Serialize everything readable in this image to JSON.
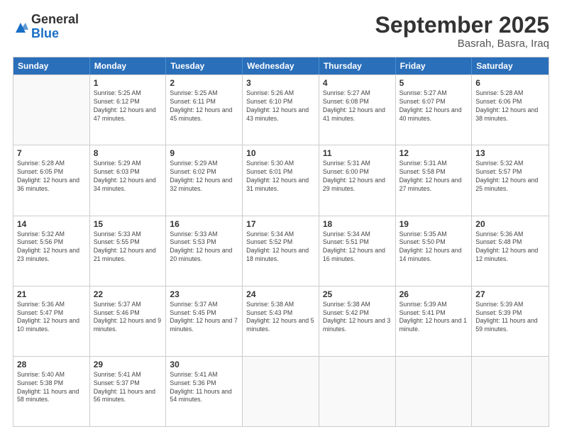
{
  "logo": {
    "general": "General",
    "blue": "Blue"
  },
  "header": {
    "month": "September 2025",
    "location": "Basrah, Basra, Iraq"
  },
  "days_of_week": [
    "Sunday",
    "Monday",
    "Tuesday",
    "Wednesday",
    "Thursday",
    "Friday",
    "Saturday"
  ],
  "weeks": [
    [
      {
        "day": "",
        "empty": true
      },
      {
        "day": "1",
        "sunrise": "Sunrise: 5:25 AM",
        "sunset": "Sunset: 6:12 PM",
        "daylight": "Daylight: 12 hours and 47 minutes."
      },
      {
        "day": "2",
        "sunrise": "Sunrise: 5:25 AM",
        "sunset": "Sunset: 6:11 PM",
        "daylight": "Daylight: 12 hours and 45 minutes."
      },
      {
        "day": "3",
        "sunrise": "Sunrise: 5:26 AM",
        "sunset": "Sunset: 6:10 PM",
        "daylight": "Daylight: 12 hours and 43 minutes."
      },
      {
        "day": "4",
        "sunrise": "Sunrise: 5:27 AM",
        "sunset": "Sunset: 6:08 PM",
        "daylight": "Daylight: 12 hours and 41 minutes."
      },
      {
        "day": "5",
        "sunrise": "Sunrise: 5:27 AM",
        "sunset": "Sunset: 6:07 PM",
        "daylight": "Daylight: 12 hours and 40 minutes."
      },
      {
        "day": "6",
        "sunrise": "Sunrise: 5:28 AM",
        "sunset": "Sunset: 6:06 PM",
        "daylight": "Daylight: 12 hours and 38 minutes."
      }
    ],
    [
      {
        "day": "7",
        "sunrise": "Sunrise: 5:28 AM",
        "sunset": "Sunset: 6:05 PM",
        "daylight": "Daylight: 12 hours and 36 minutes."
      },
      {
        "day": "8",
        "sunrise": "Sunrise: 5:29 AM",
        "sunset": "Sunset: 6:03 PM",
        "daylight": "Daylight: 12 hours and 34 minutes."
      },
      {
        "day": "9",
        "sunrise": "Sunrise: 5:29 AM",
        "sunset": "Sunset: 6:02 PM",
        "daylight": "Daylight: 12 hours and 32 minutes."
      },
      {
        "day": "10",
        "sunrise": "Sunrise: 5:30 AM",
        "sunset": "Sunset: 6:01 PM",
        "daylight": "Daylight: 12 hours and 31 minutes."
      },
      {
        "day": "11",
        "sunrise": "Sunrise: 5:31 AM",
        "sunset": "Sunset: 6:00 PM",
        "daylight": "Daylight: 12 hours and 29 minutes."
      },
      {
        "day": "12",
        "sunrise": "Sunrise: 5:31 AM",
        "sunset": "Sunset: 5:58 PM",
        "daylight": "Daylight: 12 hours and 27 minutes."
      },
      {
        "day": "13",
        "sunrise": "Sunrise: 5:32 AM",
        "sunset": "Sunset: 5:57 PM",
        "daylight": "Daylight: 12 hours and 25 minutes."
      }
    ],
    [
      {
        "day": "14",
        "sunrise": "Sunrise: 5:32 AM",
        "sunset": "Sunset: 5:56 PM",
        "daylight": "Daylight: 12 hours and 23 minutes."
      },
      {
        "day": "15",
        "sunrise": "Sunrise: 5:33 AM",
        "sunset": "Sunset: 5:55 PM",
        "daylight": "Daylight: 12 hours and 21 minutes."
      },
      {
        "day": "16",
        "sunrise": "Sunrise: 5:33 AM",
        "sunset": "Sunset: 5:53 PM",
        "daylight": "Daylight: 12 hours and 20 minutes."
      },
      {
        "day": "17",
        "sunrise": "Sunrise: 5:34 AM",
        "sunset": "Sunset: 5:52 PM",
        "daylight": "Daylight: 12 hours and 18 minutes."
      },
      {
        "day": "18",
        "sunrise": "Sunrise: 5:34 AM",
        "sunset": "Sunset: 5:51 PM",
        "daylight": "Daylight: 12 hours and 16 minutes."
      },
      {
        "day": "19",
        "sunrise": "Sunrise: 5:35 AM",
        "sunset": "Sunset: 5:50 PM",
        "daylight": "Daylight: 12 hours and 14 minutes."
      },
      {
        "day": "20",
        "sunrise": "Sunrise: 5:36 AM",
        "sunset": "Sunset: 5:48 PM",
        "daylight": "Daylight: 12 hours and 12 minutes."
      }
    ],
    [
      {
        "day": "21",
        "sunrise": "Sunrise: 5:36 AM",
        "sunset": "Sunset: 5:47 PM",
        "daylight": "Daylight: 12 hours and 10 minutes."
      },
      {
        "day": "22",
        "sunrise": "Sunrise: 5:37 AM",
        "sunset": "Sunset: 5:46 PM",
        "daylight": "Daylight: 12 hours and 9 minutes."
      },
      {
        "day": "23",
        "sunrise": "Sunrise: 5:37 AM",
        "sunset": "Sunset: 5:45 PM",
        "daylight": "Daylight: 12 hours and 7 minutes."
      },
      {
        "day": "24",
        "sunrise": "Sunrise: 5:38 AM",
        "sunset": "Sunset: 5:43 PM",
        "daylight": "Daylight: 12 hours and 5 minutes."
      },
      {
        "day": "25",
        "sunrise": "Sunrise: 5:38 AM",
        "sunset": "Sunset: 5:42 PM",
        "daylight": "Daylight: 12 hours and 3 minutes."
      },
      {
        "day": "26",
        "sunrise": "Sunrise: 5:39 AM",
        "sunset": "Sunset: 5:41 PM",
        "daylight": "Daylight: 12 hours and 1 minute."
      },
      {
        "day": "27",
        "sunrise": "Sunrise: 5:39 AM",
        "sunset": "Sunset: 5:39 PM",
        "daylight": "Daylight: 11 hours and 59 minutes."
      }
    ],
    [
      {
        "day": "28",
        "sunrise": "Sunrise: 5:40 AM",
        "sunset": "Sunset: 5:38 PM",
        "daylight": "Daylight: 11 hours and 58 minutes."
      },
      {
        "day": "29",
        "sunrise": "Sunrise: 5:41 AM",
        "sunset": "Sunset: 5:37 PM",
        "daylight": "Daylight: 11 hours and 56 minutes."
      },
      {
        "day": "30",
        "sunrise": "Sunrise: 5:41 AM",
        "sunset": "Sunset: 5:36 PM",
        "daylight": "Daylight: 11 hours and 54 minutes."
      },
      {
        "day": "",
        "empty": true
      },
      {
        "day": "",
        "empty": true
      },
      {
        "day": "",
        "empty": true
      },
      {
        "day": "",
        "empty": true
      }
    ]
  ]
}
